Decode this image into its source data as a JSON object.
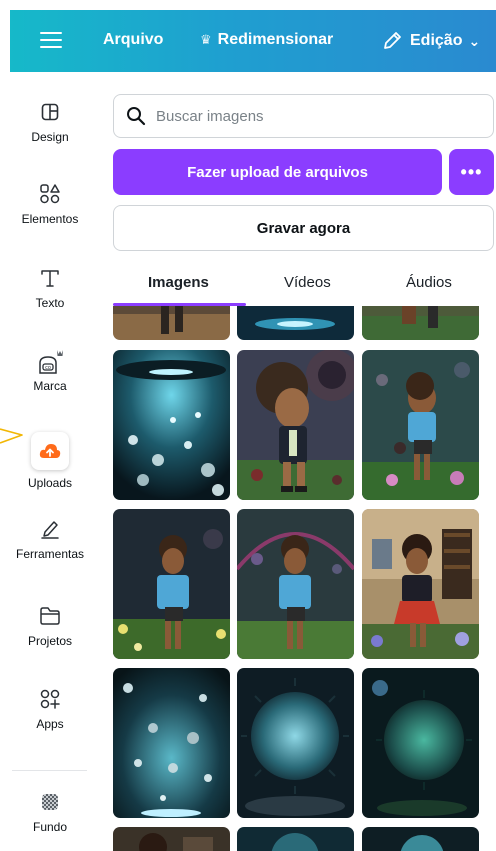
{
  "topbar": {
    "arquivo": "Arquivo",
    "redimensionar": "Redimensionar",
    "edicao": "Edição",
    "crown_icon": "crown-icon",
    "pencil_icon": "pencil-icon"
  },
  "sidebar": {
    "items": [
      {
        "label": "Design",
        "icon": "layout-icon"
      },
      {
        "label": "Elementos",
        "icon": "shapes-icon"
      },
      {
        "label": "Texto",
        "icon": "text-icon"
      },
      {
        "label": "Marca",
        "icon": "brand-icon"
      },
      {
        "label": "Uploads",
        "icon": "upload-cloud-icon"
      },
      {
        "label": "Ferramentas",
        "icon": "draw-icon"
      },
      {
        "label": "Projetos",
        "icon": "folder-icon"
      },
      {
        "label": "Apps",
        "icon": "apps-icon"
      },
      {
        "label": "Fundo",
        "icon": "background-icon"
      }
    ]
  },
  "search": {
    "placeholder": "Buscar imagens"
  },
  "buttons": {
    "upload": "Fazer upload de arquivos",
    "more": "•••",
    "record": "Gravar agora"
  },
  "tabs": [
    {
      "label": "Imagens",
      "active": true
    },
    {
      "label": "Vídeos",
      "active": false
    },
    {
      "label": "Áudios",
      "active": false
    }
  ],
  "colors": {
    "accent": "#8b3dff",
    "topbar_start": "#16b9c9",
    "topbar_end": "#2a8ad0",
    "upload_icon": "#ff6b1a"
  }
}
